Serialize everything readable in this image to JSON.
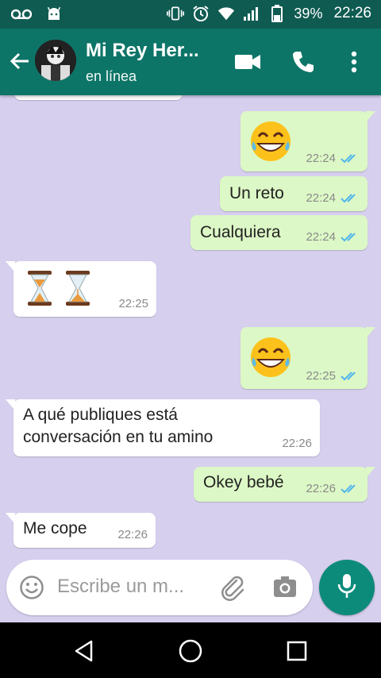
{
  "status_bar": {
    "battery": "39%",
    "time": "22:26"
  },
  "header": {
    "contact_name": "Mi Rey Her...",
    "status": "en línea"
  },
  "messages": [
    {
      "dir": "out",
      "emoji": "face-with-tears-of-joy",
      "time": "22:24"
    },
    {
      "dir": "out",
      "text": "Un reto",
      "time": "22:24"
    },
    {
      "dir": "out",
      "text": "Cualquiera",
      "time": "22:24"
    },
    {
      "dir": "in",
      "emoji": "hourglass-pair",
      "time": "22:25"
    },
    {
      "dir": "out",
      "emoji": "face-with-tears-of-joy",
      "time": "22:25"
    },
    {
      "dir": "in",
      "text_line1": "A qué publiques está",
      "text_line2": "conversación en tu amino",
      "time": "22:26"
    },
    {
      "dir": "out",
      "text": "Okey bebé",
      "time": "22:26"
    },
    {
      "dir": "in",
      "text": "Me cope",
      "time": "22:26"
    }
  ],
  "composer": {
    "placeholder": "Escribe un m..."
  },
  "colors": {
    "header": "#0d7567",
    "status_bar": "#0f5b52",
    "chat_bg": "#d7cfee",
    "outgoing": "#dcf8c6",
    "incoming": "#ffffff",
    "read_ticks": "#4fb6ec",
    "mic": "#0d8b7a"
  }
}
